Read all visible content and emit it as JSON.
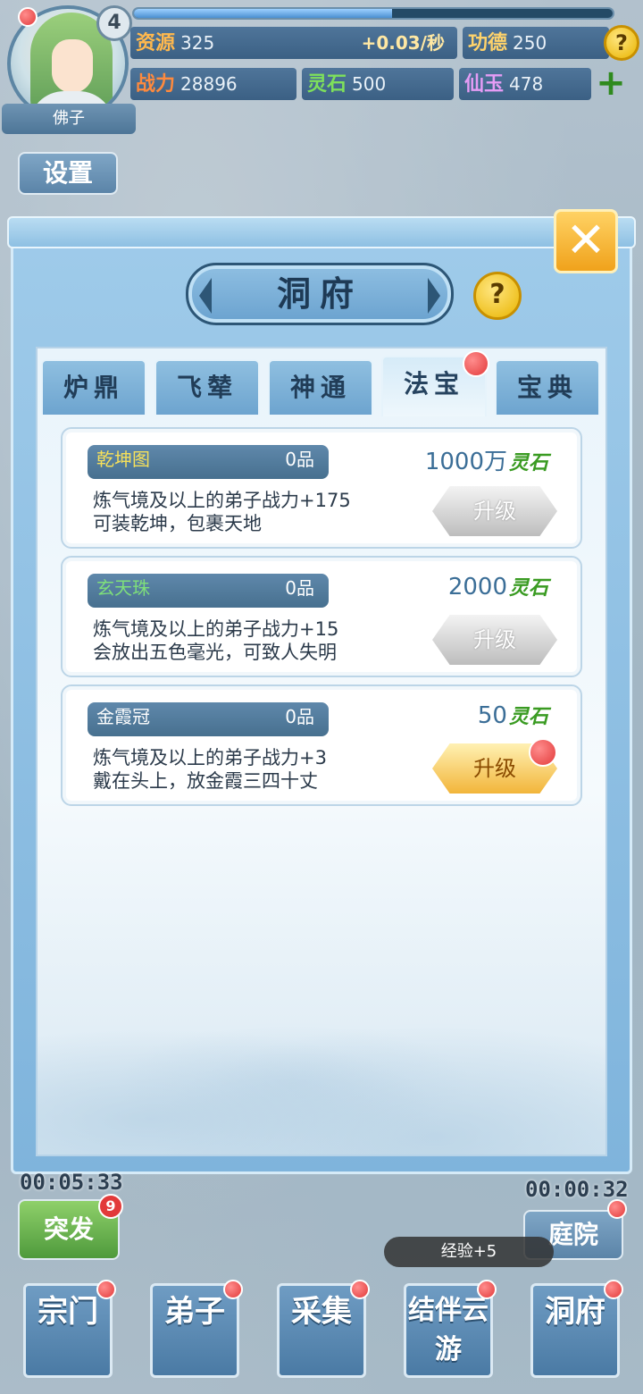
{
  "player": {
    "level": "4",
    "name": "佛子",
    "exp_progress": 0.54
  },
  "stats": {
    "resources_label": "资源",
    "resources_value": "325",
    "resources_rate": "+0.03/秒",
    "merit_label": "功德",
    "merit_value": "250",
    "power_label": "战力",
    "power_value": "28896",
    "spirit_stone_label": "灵石",
    "spirit_stone_value": "500",
    "jade_label": "仙玉",
    "jade_value": "478",
    "help_icon": "?",
    "add_icon": "+"
  },
  "side": {
    "settings_label": "设置",
    "burst_label": "突发",
    "burst_badge": "9",
    "courtyard_label": "庭院"
  },
  "dialog": {
    "title": "洞府",
    "help_icon": "?",
    "close_icon": "✕",
    "tabs": [
      {
        "label": "炉鼎"
      },
      {
        "label": "飞辇"
      },
      {
        "label": "神通"
      },
      {
        "label": "法宝"
      },
      {
        "label": "宝典"
      }
    ],
    "items": [
      {
        "name": "乾坤图",
        "name_color": "#f6e05a",
        "grade": "0品",
        "effect": "炼气境及以上的弟子战力+175",
        "desc": "可装乾坤，包裹天地",
        "cost": "1000万",
        "cost_unit": "灵石",
        "button": "升级"
      },
      {
        "name": "玄天珠",
        "name_color": "#7fe07a",
        "grade": "0品",
        "effect": "炼气境及以上的弟子战力+15",
        "desc": "会放出五色毫光，可致人失明",
        "cost": "2000",
        "cost_unit": "灵石",
        "button": "升级"
      },
      {
        "name": "金霞冠",
        "name_color": "#ffffff",
        "grade": "0品",
        "effect": "炼气境及以上的弟子战力+3",
        "desc": "戴在头上，放金霞三四十丈",
        "cost": "50",
        "cost_unit": "灵石",
        "button": "升级"
      }
    ]
  },
  "timers": {
    "left": "00:05:33",
    "right": "00:00:32"
  },
  "toast": "经验+5",
  "bottom_nav": [
    {
      "label": "宗门"
    },
    {
      "label": "弟子"
    },
    {
      "label": "采集"
    },
    {
      "label": "结伴云游"
    },
    {
      "label": "洞府"
    }
  ]
}
